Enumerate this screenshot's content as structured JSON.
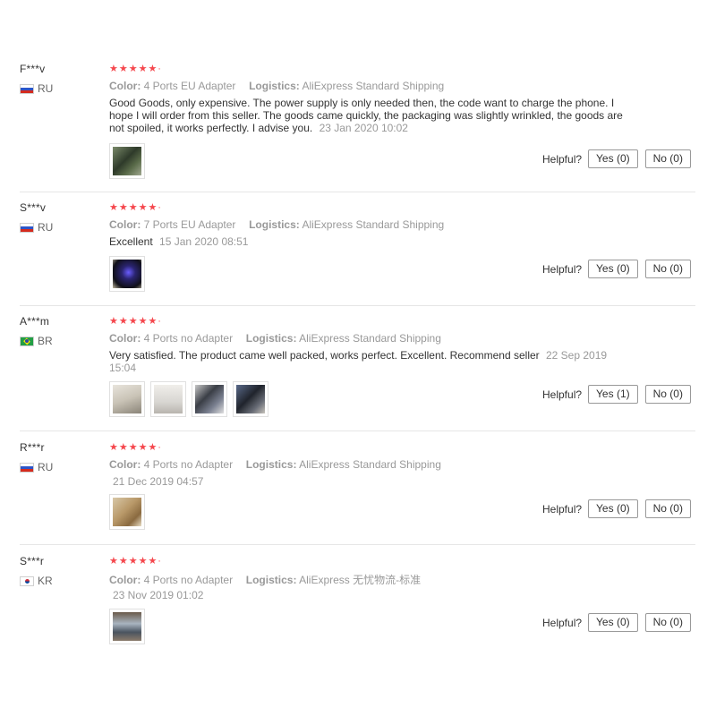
{
  "labels": {
    "color": "Color:",
    "logistics": "Logistics:",
    "helpful": "Helpful?"
  },
  "reviews": [
    {
      "user": "F***v",
      "country": "RU",
      "stars": "★★★★★·",
      "color": "4 Ports EU Adapter",
      "logistics": "AliExpress Standard Shipping",
      "text": "Good Goods, only expensive. The power supply is only needed then, the code want to charge the phone. I hope I will order from this seller. The goods came quickly, the packaging was slightly wrinkled, the goods are not spoiled, it works perfectly. I advise you.",
      "date": "23 Jan 2020 10:02",
      "yes": "Yes (0)",
      "no": "No (0)"
    },
    {
      "user": "S***v",
      "country": "RU",
      "stars": "★★★★★·",
      "color": "7 Ports EU Adapter",
      "logistics": "AliExpress Standard Shipping",
      "text": "Excellent",
      "date": "15 Jan 2020 08:51",
      "yes": "Yes (0)",
      "no": "No (0)"
    },
    {
      "user": "A***m",
      "country": "BR",
      "stars": "★★★★★·",
      "color": "4 Ports no Adapter",
      "logistics": "AliExpress Standard Shipping",
      "text": "Very satisfied. The product came well packed, works perfect. Excellent. Recommend seller",
      "date": "22 Sep 2019 15:04",
      "yes": "Yes (1)",
      "no": "No (0)"
    },
    {
      "user": "R***r",
      "country": "RU",
      "stars": "★★★★★·",
      "color": "4 Ports no Adapter",
      "logistics": "AliExpress Standard Shipping",
      "text": "",
      "date": "21 Dec 2019 04:57",
      "yes": "Yes (0)",
      "no": "No (0)"
    },
    {
      "user": "S***r",
      "country": "KR",
      "stars": "★★★★★·",
      "color": "4 Ports no Adapter",
      "logistics": "AliExpress 无忧物流-标准",
      "text": "",
      "date": "23 Nov 2019 01:02",
      "yes": "Yes (0)",
      "no": "No (0)"
    }
  ],
  "colors": {
    "star": "#f5474d",
    "muted": "#999999",
    "divider": "#e6e6e6"
  }
}
